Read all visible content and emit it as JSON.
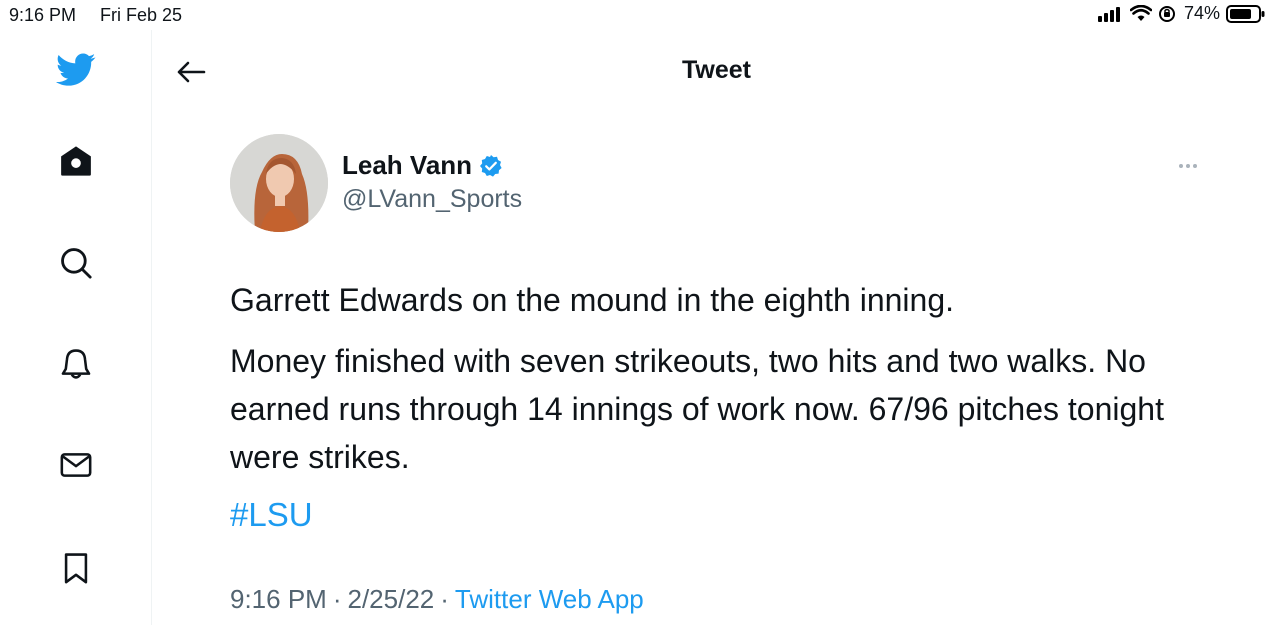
{
  "status_bar": {
    "time": "9:16 PM",
    "date": "Fri Feb 25",
    "battery": "74%"
  },
  "sidebar": {
    "items": [
      {
        "icon": "twitter-logo-icon"
      },
      {
        "icon": "home-icon"
      },
      {
        "icon": "search-icon"
      },
      {
        "icon": "bell-icon"
      },
      {
        "icon": "mail-icon"
      },
      {
        "icon": "bookmark-icon"
      }
    ]
  },
  "header": {
    "title": "Tweet"
  },
  "tweet": {
    "author_name": "Leah Vann",
    "handle": "@LVann_Sports",
    "paragraphs": [
      "Garrett Edwards on the mound in the eighth inning.",
      "Money finished with seven strikeouts, two hits and two walks. No earned runs through 14 innings of work now. 67/96 pitches tonight were strikes."
    ],
    "hashtag": "#LSU",
    "time": "9:16 PM",
    "date": "2/25/22",
    "separator": "·",
    "source": "Twitter Web App"
  },
  "colors": {
    "accent": "#1d9bf0",
    "text": "#0f1419",
    "secondary": "#536471"
  }
}
